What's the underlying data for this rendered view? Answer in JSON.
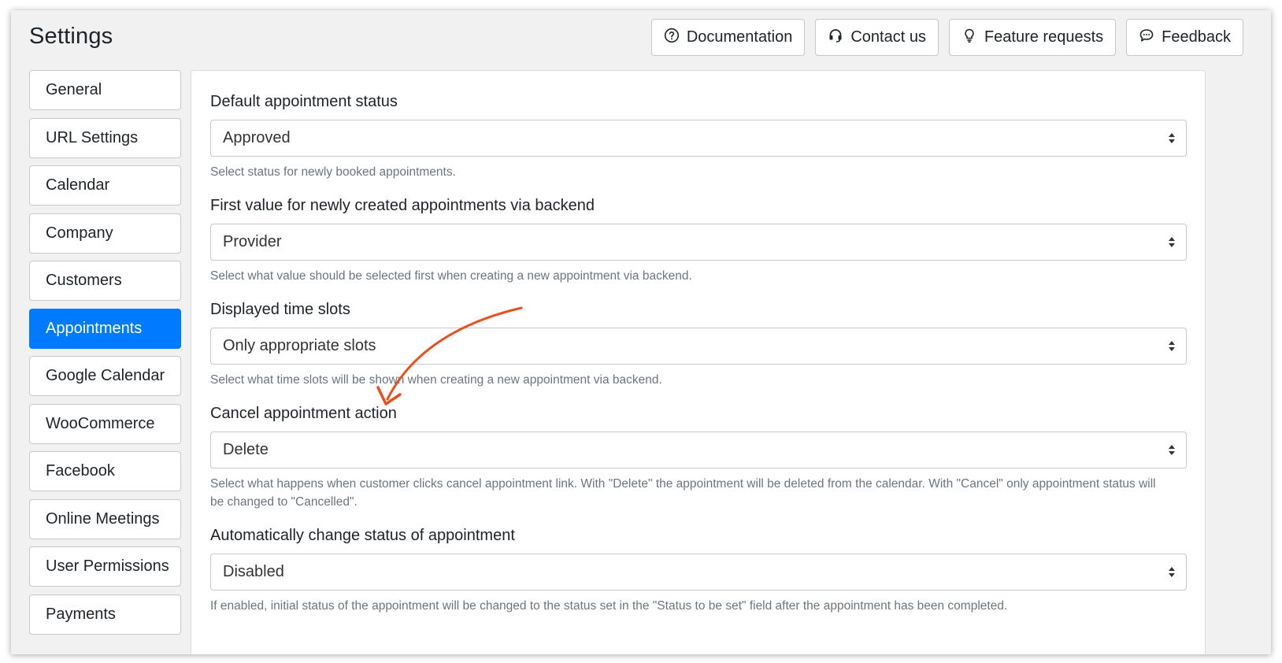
{
  "page": {
    "title": "Settings"
  },
  "header_buttons": [
    {
      "label": "Documentation",
      "icon": "question-circle-icon"
    },
    {
      "label": "Contact us",
      "icon": "headset-icon"
    },
    {
      "label": "Feature requests",
      "icon": "lightbulb-icon"
    },
    {
      "label": "Feedback",
      "icon": "chat-bubble-icon"
    }
  ],
  "sidebar": {
    "items": [
      {
        "label": "General"
      },
      {
        "label": "URL Settings"
      },
      {
        "label": "Calendar"
      },
      {
        "label": "Company"
      },
      {
        "label": "Customers"
      },
      {
        "label": "Appointments",
        "active": true
      },
      {
        "label": "Google Calendar"
      },
      {
        "label": "WooCommerce"
      },
      {
        "label": "Facebook"
      },
      {
        "label": "Online Meetings"
      },
      {
        "label": "User Permissions"
      },
      {
        "label": "Payments"
      }
    ]
  },
  "fields": [
    {
      "label": "Default appointment status",
      "value": "Approved",
      "help": "Select status for newly booked appointments."
    },
    {
      "label": "First value for newly created appointments via backend",
      "value": "Provider",
      "help": "Select what value should be selected first when creating a new appointment via backend."
    },
    {
      "label": "Displayed time slots",
      "value": "Only appropriate slots",
      "help": "Select what time slots will be shown when creating a new appointment via backend."
    },
    {
      "label": "Cancel appointment action",
      "value": "Delete",
      "help": "Select what happens when customer clicks cancel appointment link. With \"Delete\" the appointment will be deleted from the calendar. With \"Cancel\" only appointment status will be changed to \"Cancelled\"."
    },
    {
      "label": "Automatically change status of appointment",
      "value": "Disabled",
      "help": "If enabled, initial status of the appointment will be changed to the status set in the \"Status to be set\" field after the appointment has been completed."
    }
  ],
  "colors": {
    "accent": "#007bff",
    "annotation_arrow": "#e8501e",
    "frame_bg": "#f1f1f1"
  }
}
